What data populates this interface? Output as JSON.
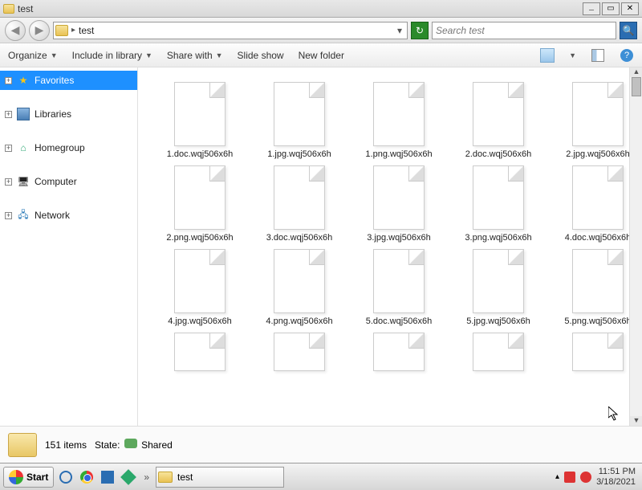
{
  "window": {
    "title": "test",
    "min": "_",
    "max": "▭",
    "close": "✕"
  },
  "nav": {
    "back": "◀",
    "forward": "▶",
    "address_crumb": "test",
    "addr_sep": "▸",
    "addr_drop": "▾",
    "refresh": "↻",
    "search_placeholder": "Search test",
    "search_icon": "🔍"
  },
  "toolbar": {
    "organize": "Organize",
    "include": "Include in library",
    "share": "Share with",
    "slideshow": "Slide show",
    "newfolder": "New folder",
    "dd": "▼",
    "help": "?"
  },
  "sidebar": {
    "items": [
      {
        "label": "Favorites",
        "icon": "star",
        "selected": true
      },
      {
        "label": "Libraries",
        "icon": "lib"
      },
      {
        "label": "Homegroup",
        "icon": "home"
      },
      {
        "label": "Computer",
        "icon": "comp"
      },
      {
        "label": "Network",
        "icon": "net"
      }
    ],
    "expander": "+"
  },
  "files": [
    "1.doc.wqj506x6h",
    "1.jpg.wqj506x6h",
    "1.png.wqj506x6h",
    "2.doc.wqj506x6h",
    "2.jpg.wqj506x6h",
    "2.png.wqj506x6h",
    "3.doc.wqj506x6h",
    "3.jpg.wqj506x6h",
    "3.png.wqj506x6h",
    "4.doc.wqj506x6h",
    "4.jpg.wqj506x6h",
    "4.png.wqj506x6h",
    "5.doc.wqj506x6h",
    "5.jpg.wqj506x6h",
    "5.png.wqj506x6h"
  ],
  "status": {
    "count_label": "151 items",
    "state_label": "State:",
    "shared": "Shared"
  },
  "taskbar": {
    "start": "Start",
    "overflow": "»",
    "task_label": "test",
    "tray_expand": "▴",
    "time": "11:51 PM",
    "date": "3/18/2021"
  }
}
